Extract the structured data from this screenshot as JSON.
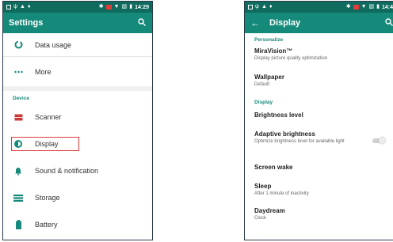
{
  "left_screen": {
    "status_time": "14:29",
    "title": "Settings",
    "items_top": [
      {
        "label": "Data usage",
        "icon": "data-usage-icon"
      },
      {
        "label": "More",
        "icon": "more-dots-icon"
      }
    ],
    "section_device": "Device",
    "items_device": [
      {
        "label": "Scanner",
        "icon": "scanner-icon"
      },
      {
        "label": "Display",
        "icon": "brightness-icon"
      },
      {
        "label": "Sound & notification",
        "icon": "bell-icon"
      },
      {
        "label": "Storage",
        "icon": "storage-icon"
      },
      {
        "label": "Battery",
        "icon": "battery-icon"
      }
    ]
  },
  "right_screen": {
    "status_time": "14:4",
    "title": "Display",
    "section_personalize": "Personalize",
    "miravision_title": "MiraVision™",
    "miravision_sub": "Display picture quality optimization",
    "wallpaper_title": "Wallpaper",
    "wallpaper_sub": "Default",
    "section_display": "Display",
    "brightness_title": "Brightness level",
    "adaptive_title": "Adaptive brightness",
    "adaptive_sub": "Optimize brightness level for available light",
    "screenwake_title": "Screen wake",
    "sleep_title": "Sleep",
    "sleep_sub": "After 1 minute of inactivity",
    "daydream_title": "Daydream",
    "daydream_sub": "Clock"
  },
  "colors": {
    "statusbar": "#0e6b5e",
    "appbar": "#168a7a",
    "accent": "#168a7a",
    "highlight": "#d93a3a"
  }
}
